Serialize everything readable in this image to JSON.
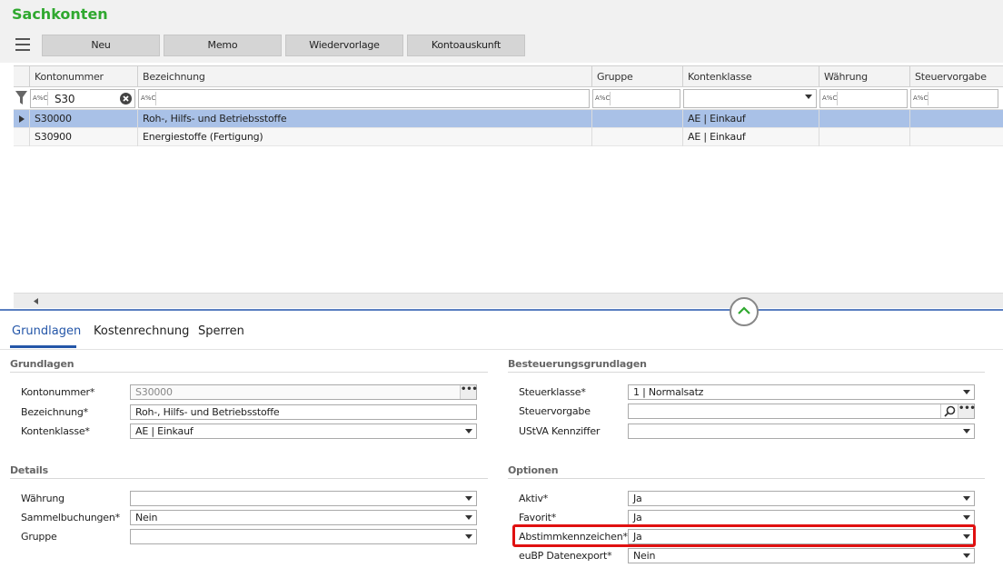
{
  "page": {
    "title": "Sachkonten"
  },
  "toolbar": {
    "buttons": [
      "Neu",
      "Memo",
      "Wiedervorlage",
      "Kontoauskunft"
    ]
  },
  "grid": {
    "columns": [
      "Kontonummer",
      "Bezeichnung",
      "Gruppe",
      "Kontenklasse",
      "Währung",
      "Steuervorgabe"
    ],
    "filter": {
      "tag": "A%C",
      "kontonummer": "S30"
    },
    "rows": [
      {
        "kontonummer": "S30000",
        "bezeichnung": "Roh-, Hilfs- und Betriebsstoffe",
        "gruppe": "",
        "kontenklasse": "AE  |  Einkauf",
        "waehrung": "",
        "steuervorgabe": ""
      },
      {
        "kontonummer": "S30900",
        "bezeichnung": "Energiestoffe (Fertigung)",
        "gruppe": "",
        "kontenklasse": "AE  |  Einkauf",
        "waehrung": "",
        "steuervorgabe": ""
      }
    ],
    "selected_row": 0
  },
  "tabs": [
    "Grundlagen",
    "Kostenrechnung",
    "Sperren"
  ],
  "active_tab": "Grundlagen",
  "grundlagen": {
    "title": "Grundlagen",
    "fields": [
      {
        "label": "Kontonummer*",
        "value": "S30000"
      },
      {
        "label": "Bezeichnung*",
        "value": "Roh-, Hilfs- und Betriebsstoffe"
      },
      {
        "label": "Kontenklasse*",
        "value": "AE  |  Einkauf"
      }
    ]
  },
  "details": {
    "title": "Details",
    "fields": [
      {
        "label": "Währung",
        "value": ""
      },
      {
        "label": "Sammelbuchungen*",
        "value": "Nein"
      },
      {
        "label": "Gruppe",
        "value": ""
      }
    ]
  },
  "besteuerung": {
    "title": "Besteuerungsgrundlagen",
    "fields": [
      {
        "label": "Steuerklasse*",
        "value": "1  |  Normalsatz"
      },
      {
        "label": "Steuervorgabe",
        "value": ""
      },
      {
        "label": "UStVA Kennziffer",
        "value": ""
      }
    ]
  },
  "optionen": {
    "title": "Optionen",
    "fields": [
      {
        "label": "Aktiv*",
        "value": "Ja"
      },
      {
        "label": "Favorit*",
        "value": "Ja"
      },
      {
        "label": "Abstimmkennzeichen*",
        "value": "Ja"
      },
      {
        "label": "euBP Datenexport*",
        "value": "Nein"
      }
    ]
  },
  "colors": {
    "accent_green": "#2fa82f",
    "tab_blue": "#2456a8",
    "selection": "#a9c1e7",
    "highlight_red": "#e01010"
  },
  "icons": [
    "menu-icon",
    "filter-icon",
    "clear-icon",
    "row-indicator-icon",
    "scroll-left-icon",
    "chevron-up-icon",
    "dropdown-arrow-icon",
    "ellipsis-icon",
    "search-icon"
  ]
}
